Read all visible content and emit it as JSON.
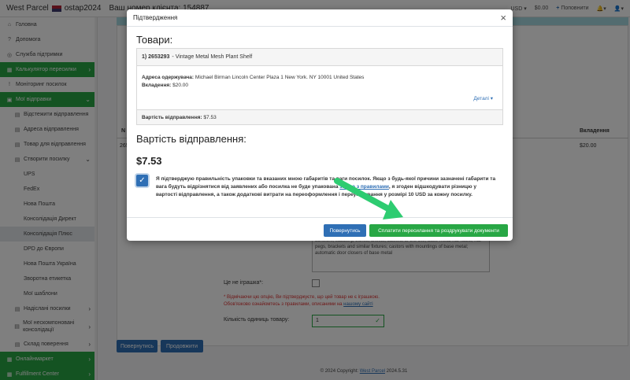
{
  "topbar": {
    "brand": "West Parcel",
    "user": "ostap2024",
    "subtitle": "Ваш номер клієнта: 154887",
    "usd": "USD ▾",
    "balance": "$0.00",
    "top_up": "Поповнити",
    "bell": "▾",
    "user_menu": "▾"
  },
  "sidebar": {
    "items": [
      {
        "icon": "home-icon",
        "label": "Головна"
      },
      {
        "icon": "help-icon",
        "label": "Допомога"
      },
      {
        "icon": "support-icon",
        "label": "Служба підтримки"
      },
      {
        "icon": "calculator-icon",
        "label": "Калькулятор пересилки"
      },
      {
        "icon": "info-icon",
        "label": "Моніторинг посилок"
      },
      {
        "icon": "box-icon",
        "label": "Мої відправки"
      },
      {
        "icon": "track-icon",
        "label": "Відстежити відправлення"
      },
      {
        "icon": "address-icon",
        "label": "Адреса відправлення"
      },
      {
        "icon": "goods-icon",
        "label": "Товар для відправлення"
      },
      {
        "icon": "create-icon",
        "label": "Створити посилку"
      },
      {
        "label": "UPS"
      },
      {
        "label": "FedEx"
      },
      {
        "label": "Нова Пошта"
      },
      {
        "label": "Консолідація Директ"
      },
      {
        "label": "Консолідація Плюс"
      },
      {
        "label": "DPD до Європи"
      },
      {
        "label": "Нова Пошта Україна"
      },
      {
        "label": "Зворотна етикетка"
      },
      {
        "label": "Мої шаблони"
      },
      {
        "icon": "inbox-icon",
        "label": "Надіслані посилки"
      },
      {
        "icon": "unconsolidated-icon",
        "label": "Мої нескомпоновані консолідації"
      },
      {
        "icon": "warehouse-icon",
        "label": "Склад поверення"
      },
      {
        "icon": "store-icon",
        "label": "Онлайнмаркет"
      },
      {
        "icon": "fulfillment-icon",
        "label": "Fulfillment Center"
      }
    ]
  },
  "background": {
    "table_col_n": "N",
    "table_col_attach": "Вкладення",
    "row_value": "$20.00",
    "row_id": "265",
    "textarea": "achwork, saddlery, trunks, chests, caskets or the like; base-metal hat-racks, hat-pegs, brackets and similar fixtures; castors with mountings of base metal; automatic door closers of base metal",
    "toy_label": "Це не іграшка*:",
    "toy_warning_1": "* Відмічаючи цю опцію, Ви підтверджуєте, що цей товар не є іграшкою.",
    "toy_warning_2": "Обов'язково ознайомтесь з правилами, описаними на",
    "toy_link": "нашому сайті",
    "qty_label": "Кількість одиниць товару:",
    "qty_value": "1",
    "btn_back": "Повернутись",
    "btn_continue": "Продовжити",
    "footer": "© 2024 Copyright:",
    "footer_link": "West Parcel",
    "footer_ver": "2024.5.31"
  },
  "modal": {
    "title": "Підтвердження",
    "goods_heading": "Товари:",
    "item_number": "1) 2653293",
    "item_name": "- Vintage Metal Mesh Plant Shelf",
    "recipient_label": "Адреса одержувача:",
    "recipient_value": "Michael Birman Lincoln Center Plaza 1 New York. NY 10001 United States",
    "attachments_label": "Вкладення:",
    "attachments_value": "$20.00",
    "details": "Деталі ▾",
    "shipping_cost_label": "Вартість відправлення:",
    "shipping_cost_value": "$7.53",
    "cost_heading": "Вартість відправлення:",
    "cost_total": "$7.53",
    "confirm_text_1": "Я підтверджую правильність упаковки та вказаних мною габаритів та ваги посилок. Якщо з будь-якої причини зазначені габарити та вага будуть відрізнятися від заявлених або посилка не буде упакована",
    "confirm_link": "згідно з правилами",
    "confirm_text_2": ", я згоден відшкодувати різницю у вартості відправлення, а також додаткові витрати на переоформлення і переупакування у розмірі 10 USD за кожну посилку.",
    "btn_back": "Повернутись",
    "btn_pay": "Сплатити пересилання та роздрукувати документи"
  },
  "colors": {
    "primary": "#2f6fb5",
    "success": "#28a745",
    "arrow": "#2ecc71"
  }
}
